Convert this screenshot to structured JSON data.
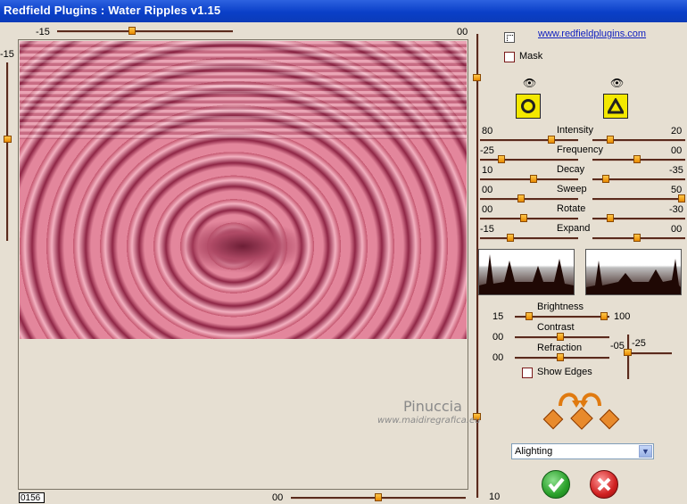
{
  "window": {
    "title": "Redfield Plugins : Water Ripples v1.15"
  },
  "link": "www.redfieldplugins.com",
  "top_slider": {
    "min_label": "-15",
    "max_label": "00"
  },
  "left_slider": {
    "label": "-15"
  },
  "bottom_slider": {
    "min_label": "00",
    "max_label": "10"
  },
  "counter": "0156",
  "mask": {
    "label": "Mask",
    "checked": false
  },
  "params": [
    {
      "name": "Intensity",
      "left": "80",
      "right": "20"
    },
    {
      "name": "Frequency",
      "left": "-25",
      "right": "00"
    },
    {
      "name": "Decay",
      "left": "10",
      "right": "-35"
    },
    {
      "name": "Sweep",
      "left": "00",
      "right": "50"
    },
    {
      "name": "Rotate",
      "left": "00",
      "right": "-30"
    },
    {
      "name": "Expand",
      "left": "-15",
      "right": "00"
    }
  ],
  "lighting": {
    "brightness": {
      "label": "Brightness",
      "min": "15",
      "max": "100"
    },
    "contrast": {
      "label": "Contrast",
      "value": "00"
    },
    "refraction": {
      "label": "Refraction",
      "value": "00"
    },
    "side_slider": {
      "left": "-05",
      "right": "-25"
    },
    "show_edges": {
      "label": "Show Edges",
      "checked": false
    }
  },
  "watermark": {
    "name": "Pinuccia",
    "site": "www.maidiregrafica.eu"
  },
  "dropdown": {
    "selected": "Alighting"
  },
  "colors": {
    "titlebar": "#0a3fc8",
    "ok": "#2aa02a",
    "cancel": "#d02020",
    "accent": "#e88a00"
  }
}
